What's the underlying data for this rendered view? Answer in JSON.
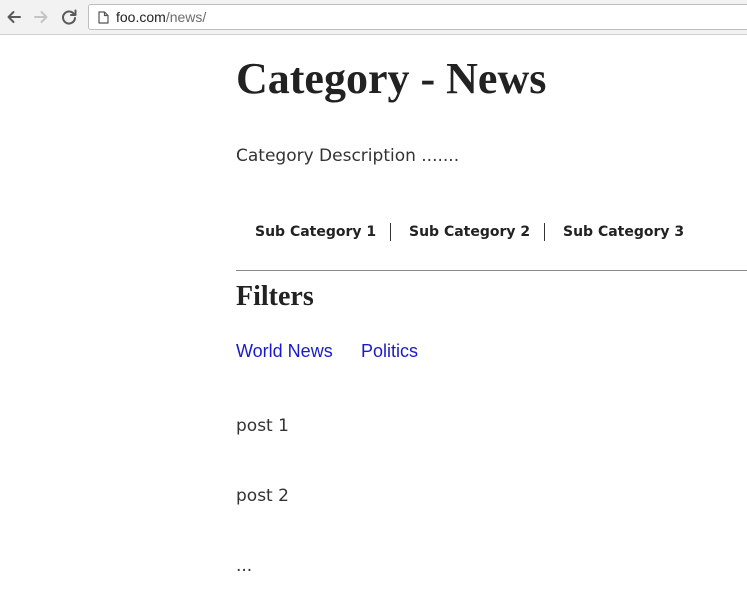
{
  "browser": {
    "url_host": "foo.com",
    "url_path": "/news/"
  },
  "page": {
    "title": "Category - News",
    "description": "Category Description .......",
    "subcategories": [
      {
        "label": "Sub Category 1"
      },
      {
        "label": "Sub Category 2"
      },
      {
        "label": "Sub Category 3"
      }
    ],
    "filters_heading": "Filters",
    "filters": [
      {
        "label": "World News"
      },
      {
        "label": "Politics"
      }
    ],
    "posts": [
      {
        "label": "post 1"
      },
      {
        "label": "post 2"
      },
      {
        "label": "..."
      }
    ]
  },
  "colors": {
    "link": "#1a1acc",
    "text": "#222222",
    "toolbar": "#f2f2f2"
  },
  "icons": {
    "back": "arrow-left-icon",
    "forward": "arrow-right-icon",
    "reload": "reload-icon",
    "page": "page-icon"
  }
}
